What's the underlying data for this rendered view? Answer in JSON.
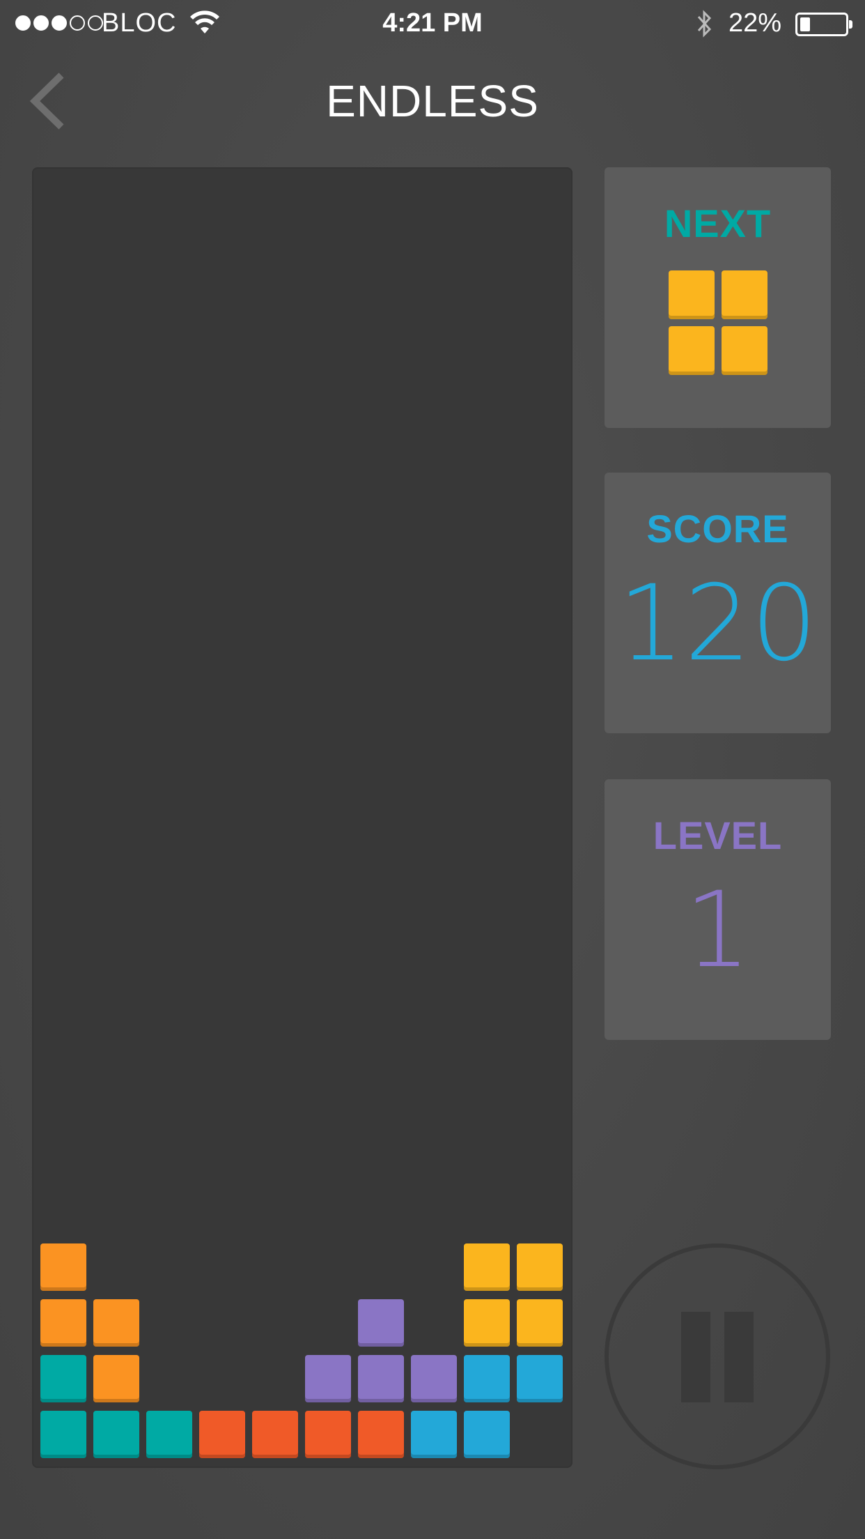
{
  "status_bar": {
    "carrier": "BLOC",
    "signal_strength": 3,
    "signal_max": 5,
    "time": "4:21 PM",
    "battery": "22%",
    "battery_level": 0.22
  },
  "nav": {
    "back_icon": "chevron-left-icon",
    "title": "ENDLESS"
  },
  "colors": {
    "teal": "#00aaa4",
    "blue": "#23a8d8",
    "purple": "#8a75c5",
    "orange": "#fb9322",
    "yellow": "#fbb51e",
    "red": "#f05a28",
    "panel": "#5c5c5c",
    "board": "#383838"
  },
  "board": {
    "columns": 10,
    "rows": 4,
    "cells": [
      [
        "orange",
        null,
        null,
        null,
        null,
        null,
        null,
        null,
        "yellow",
        "yellow"
      ],
      [
        "orange",
        "orange",
        null,
        null,
        null,
        null,
        "purple",
        null,
        "yellow",
        "yellow"
      ],
      [
        "teal",
        "orange",
        null,
        null,
        null,
        "purple",
        "purple",
        "purple",
        "blue",
        "blue"
      ],
      [
        "teal",
        "teal",
        "teal",
        "red",
        "red",
        "red",
        "red",
        "blue",
        "blue",
        null
      ]
    ]
  },
  "next": {
    "label": "NEXT",
    "label_color": "#00aaa4",
    "piece_color": "yellow",
    "piece_cells": [
      [
        1,
        1
      ],
      [
        1,
        1
      ]
    ]
  },
  "score": {
    "label": "SCORE",
    "value": "120",
    "color": "#23a8d8"
  },
  "level": {
    "label": "LEVEL",
    "value": "1",
    "color": "#8a75c5"
  },
  "pause_button": {
    "icon": "pause-icon"
  }
}
